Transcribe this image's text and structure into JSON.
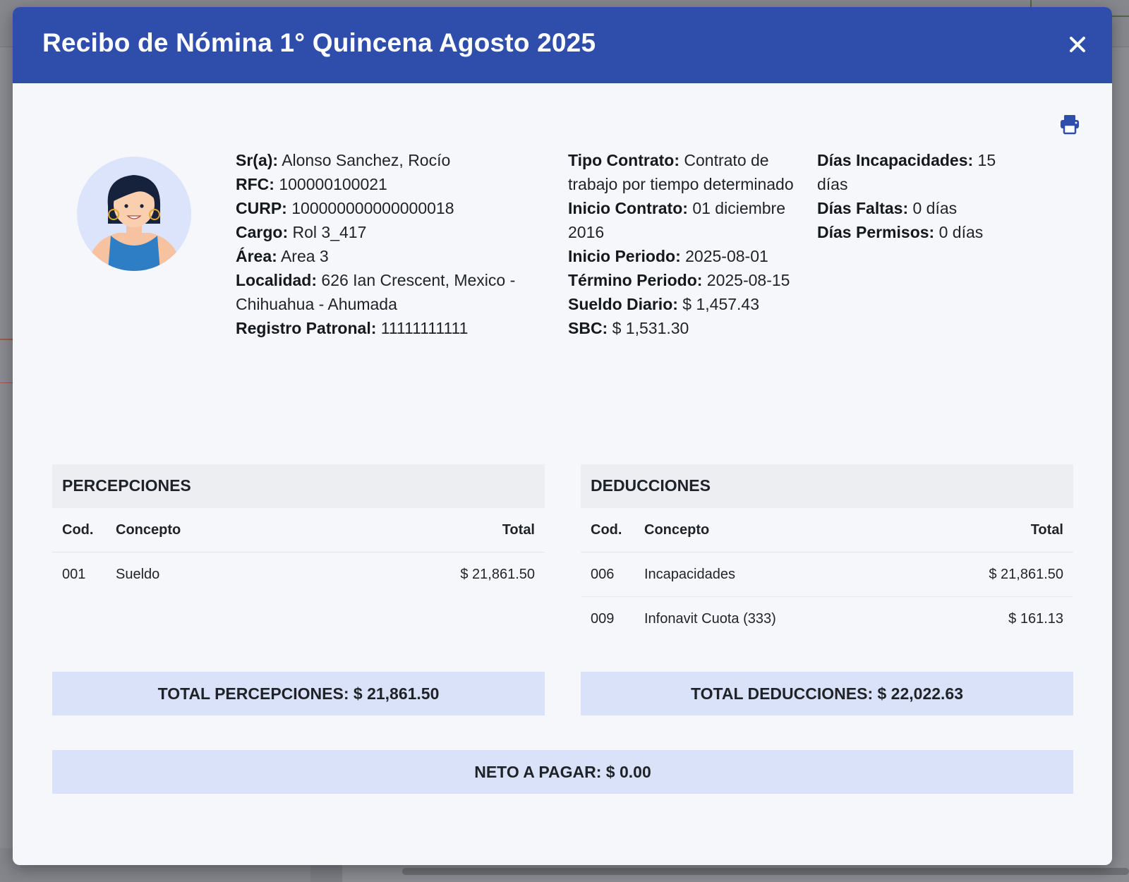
{
  "modal": {
    "title": "Recibo de Nómina 1° Quincena Agosto 2025",
    "close_icon": "close-icon",
    "print_icon": "printer-icon"
  },
  "employee": {
    "name_label": "Sr(a):",
    "name": "Alonso Sanchez, Rocío",
    "rfc_label": "RFC:",
    "rfc": "100000100021",
    "curp_label": "CURP:",
    "curp": "100000000000000018",
    "cargo_label": "Cargo:",
    "cargo": "Rol 3_417",
    "area_label": "Área:",
    "area": "Area 3",
    "localidad_label": "Localidad:",
    "localidad": "626 Ian Crescent, Mexico - Chihuahua - Ahumada",
    "registro_label": "Registro Patronal:",
    "registro": "11111111111"
  },
  "contract": {
    "tipo_label": "Tipo Contrato:",
    "tipo": "Contrato de trabajo por tiempo determinado",
    "inicio_contrato_label": "Inicio Contrato:",
    "inicio_contrato": "01 diciembre 2016",
    "inicio_periodo_label": "Inicio Periodo:",
    "inicio_periodo": "2025-08-01",
    "termino_periodo_label": "Término Periodo:",
    "termino_periodo": "2025-08-15",
    "sueldo_diario_label": "Sueldo Diario:",
    "sueldo_diario": "$ 1,457.43",
    "sbc_label": "SBC:",
    "sbc": "$ 1,531.30"
  },
  "attendance": {
    "incapacidades_label": "Días Incapacidades:",
    "incapacidades": "15 días",
    "faltas_label": "Días Faltas:",
    "faltas": "0 días",
    "permisos_label": "Días Permisos:",
    "permisos": "0 días"
  },
  "percepciones": {
    "title": "PERCEPCIONES",
    "headers": {
      "cod": "Cod.",
      "concepto": "Concepto",
      "total": "Total"
    },
    "rows": [
      {
        "cod": "001",
        "concepto": "Sueldo",
        "total": "$ 21,861.50"
      }
    ],
    "total": "TOTAL PERCEPCIONES: $ 21,861.50"
  },
  "deducciones": {
    "title": "DEDUCCIONES",
    "headers": {
      "cod": "Cod.",
      "concepto": "Concepto",
      "total": "Total"
    },
    "rows": [
      {
        "cod": "006",
        "concepto": "Incapacidades",
        "total": "$ 21,861.50"
      },
      {
        "cod": "009",
        "concepto": "Infonavit Cuota (333)",
        "total": "$ 161.13"
      }
    ],
    "total": "TOTAL DEDUCCIONES: $ 22,022.63"
  },
  "neto": "NETO A PAGAR: $ 0.00",
  "colors": {
    "header": "#2f4dab",
    "total_bar": "#d9e2f8",
    "panel_title": "#eceef2",
    "modal_bg": "#f5f7fa"
  }
}
